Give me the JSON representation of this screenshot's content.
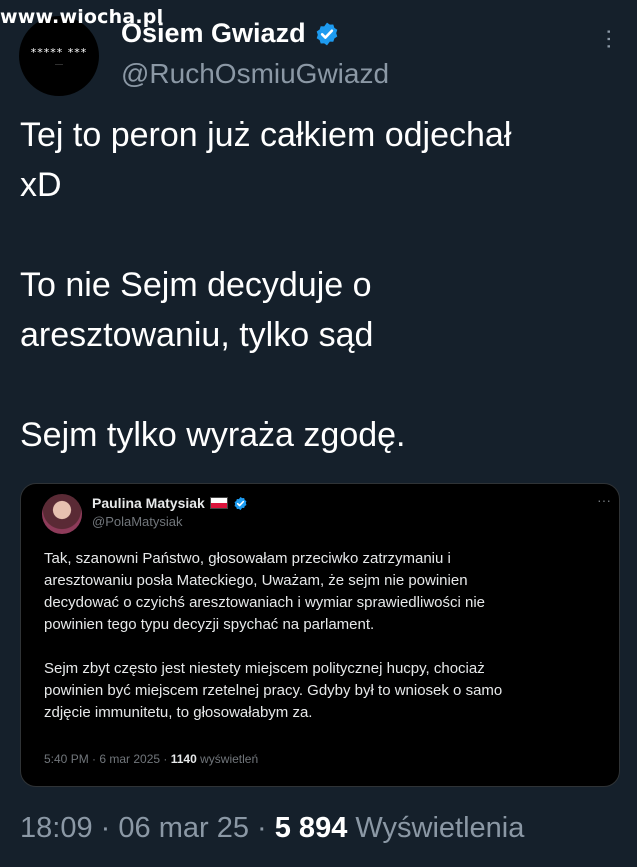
{
  "watermark": {
    "text": "www.wiocha.pl"
  },
  "author": {
    "avatar_text": "***** ***",
    "display_name": "Osiem Gwiazd",
    "handle": "@RuchOsmiuGwiazd"
  },
  "tweet": {
    "lines": [
      "Tej to peron już całkiem odjechał",
      "xD",
      "To nie Sejm decyduje o",
      "aresztowaniu, tylko sąd",
      "Sejm tylko wyraża zgodę."
    ],
    "time": "18:09",
    "date": "06 mar 25",
    "views_count": "5 894",
    "views_label": "Wyświetlenia"
  },
  "quoted": {
    "display_name": "Paulina Matysiak",
    "handle": "@PolaMatysiak",
    "paragraph1": [
      "Tak, szanowni Państwo, głosowałam przeciwko zatrzymaniu i",
      "aresztowaniu posła Mateckiego, Uważam, że sejm nie powinien",
      "decydować o czyichś aresztowaniach i wymiar sprawiedliwości nie",
      "powinien tego typu decyzji spychać na parlament."
    ],
    "paragraph2": [
      "Sejm zbyt często jest niestety miejscem politycznej hucpy, chociaż",
      "powinien być miejscem rzetelnej pracy. Gdyby był to wniosek o samo",
      "zdjęcie immunitetu, to głosowałabym za."
    ],
    "meta_time": "5:40 PM · 6 mar 2025 ·",
    "meta_views_count": "1140",
    "meta_views_label": "wyświetleń"
  },
  "colors": {
    "background": "#15202b",
    "verified": "#1d9bf0",
    "secondary_text": "#8b98a5"
  },
  "icons": [
    "verified-badge-icon",
    "more-options-icon",
    "poland-flag-icon"
  ]
}
